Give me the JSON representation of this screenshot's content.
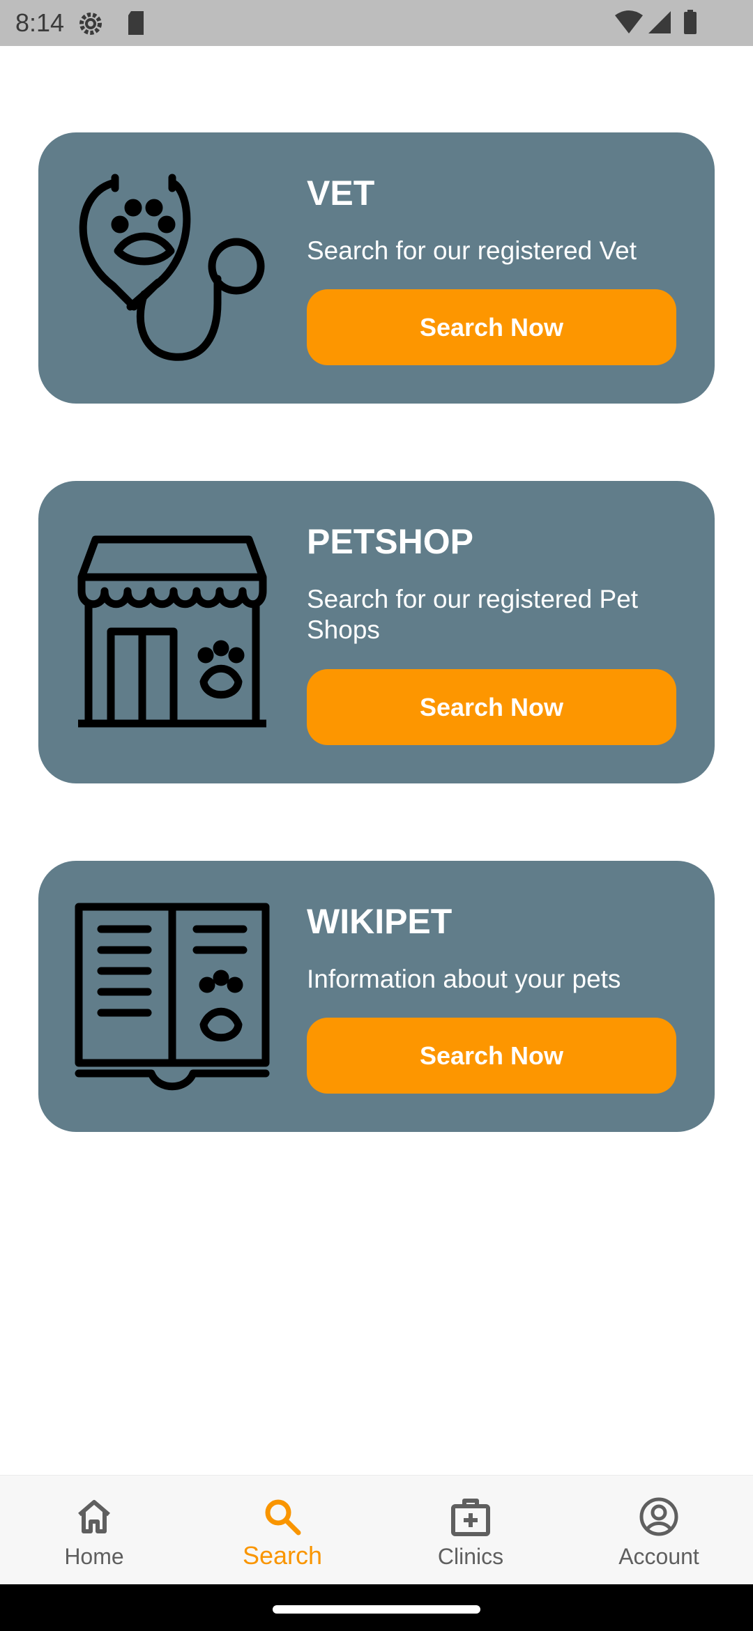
{
  "status_bar": {
    "time": "8:14",
    "icons": [
      "settings-gear-icon",
      "sd-card-icon",
      "wifi-icon",
      "cell-signal-icon",
      "battery-icon"
    ]
  },
  "cards": [
    {
      "title": "VET",
      "description": "Search for our registered Vet",
      "button_label": "Search Now",
      "icon": "stethoscope-paw-icon"
    },
    {
      "title": "PETSHOP",
      "description": "Search for our registered Pet Shops",
      "button_label": "Search Now",
      "icon": "pet-shop-store-icon"
    },
    {
      "title": "WIKIPET",
      "description": "Information about your pets",
      "button_label": "Search Now",
      "icon": "open-book-paw-icon"
    }
  ],
  "bottom_nav": {
    "items": [
      {
        "label": "Home",
        "icon": "home-icon"
      },
      {
        "label": "Search",
        "icon": "search-icon",
        "active": true
      },
      {
        "label": "Clinics",
        "icon": "clinic-medical-bag-icon"
      },
      {
        "label": "Account",
        "icon": "account-circle-icon"
      }
    ]
  },
  "colors": {
    "card_background": "#617d8a",
    "button_accent": "#fd9600",
    "nav_active": "#f99500",
    "status_bar": "#bdbdbd"
  }
}
